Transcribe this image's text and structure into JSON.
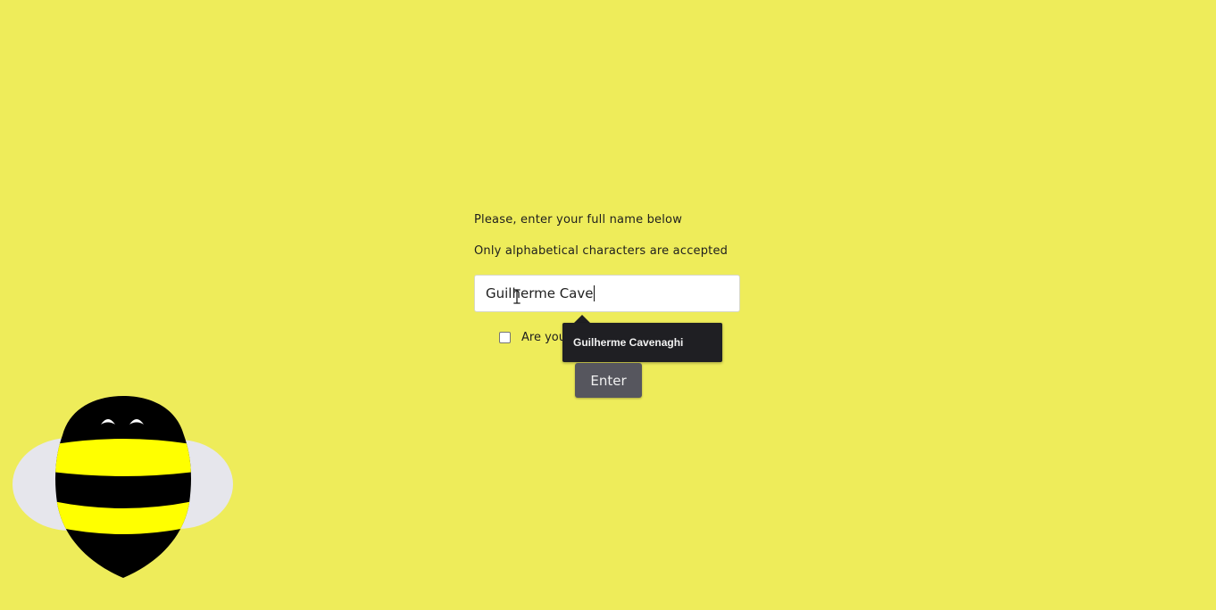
{
  "form": {
    "instruction_line1": "Please, enter your full name below",
    "instruction_line2": "Only alphabetical characters are accepted",
    "name_input_value": "Guilherme Cave",
    "checkbox_label_visible": "Are you",
    "checkbox_checked": false,
    "autocomplete_suggestion": "Guilherme Cavenaghi",
    "enter_button_label": "Enter"
  },
  "cursor": "text-ibeam",
  "mascot": "bee-icon",
  "colors": {
    "background": "#eeec5a",
    "suggestion_bg": "#1f1f23",
    "button_bg": "#56565e",
    "bee_yellow": "#ffff00",
    "bee_black": "#000000",
    "bee_wings": "#e6e6ec"
  }
}
